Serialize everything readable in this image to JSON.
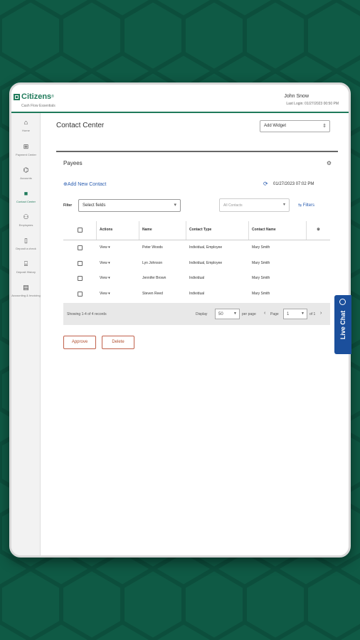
{
  "header": {
    "logo_text": "Citizens",
    "logo_tm": "®",
    "logo_sub": "Cash Flow Essentials",
    "user_name": "John Snow",
    "last_login": "Last Login: 01/27/2023 00:50 PM"
  },
  "sidebar": {
    "items": [
      {
        "label": "Home",
        "icon": "home-icon"
      },
      {
        "label": "Payment Center",
        "icon": "payment-center-icon"
      },
      {
        "label": "Accounts",
        "icon": "bank-icon"
      },
      {
        "label": "Contact Center",
        "icon": "contact-book-icon"
      },
      {
        "label": "Employees",
        "icon": "people-icon"
      },
      {
        "label": "Deposit a check",
        "icon": "phone-icon"
      },
      {
        "label": "Deposit History",
        "icon": "history-icon"
      },
      {
        "label": "Accounting & Invoicing",
        "icon": "accounting-icon"
      }
    ]
  },
  "main": {
    "title": "Contact Center",
    "add_widget": "Add Widget"
  },
  "panel": {
    "title": "Payees",
    "add_contact": "Add New Contact",
    "timestamp": "01/27/2023 07:02 PM",
    "filter_label": "Filter",
    "select_fields": "Select fields",
    "all_contacts": "All Contacts",
    "filters_link": "Filters"
  },
  "grid": {
    "columns": [
      "Actions",
      "Name",
      "Contact Type",
      "Contact Name"
    ],
    "rows": [
      {
        "action": "View",
        "name": "Peter Woods",
        "type": "Individual, Employee",
        "contact": "Mary Smith"
      },
      {
        "action": "View",
        "name": "Lyn Johnson",
        "type": "Individual, Employee",
        "contact": "Mary Smith"
      },
      {
        "action": "View",
        "name": "Jennifer Brown",
        "type": "Individual",
        "contact": "Mary Smith"
      },
      {
        "action": "View",
        "name": "Steven Reed",
        "type": "Individual",
        "contact": "Mary Smith"
      }
    ],
    "footer": {
      "showing": "Showing 1-4 of 4 records",
      "display": "Display",
      "per_page_value": "50",
      "per_page_label": "per page",
      "page_label": "Page",
      "page_value": "1",
      "of_label": "of 1"
    }
  },
  "actions": {
    "approve": "Approve",
    "delete": "Delete"
  },
  "live_chat": "Live Chat",
  "colors": {
    "background": "#0f5a45",
    "brand_green": "#1f7a5a",
    "link_blue": "#2a5db0",
    "chat_blue": "#1b4f9c",
    "button_border": "#c0604a"
  }
}
